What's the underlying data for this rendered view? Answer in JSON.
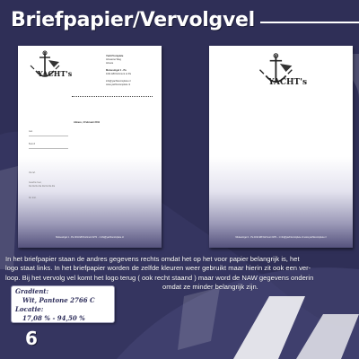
{
  "page": {
    "title": "Briefpapier/Vervolgvel",
    "page_number": "6"
  },
  "colors": {
    "background": "#2f2f57",
    "accent": "#ffffff",
    "gradient_dark": "#55527d"
  },
  "letterhead": {
    "logo_text": "YACHT's",
    "sender_lines": [
      "Yacht'Complete",
      "Almeerse Weg",
      "Almere",
      "",
      "Mutsesingel 1 - Pa",
      "1011 EB Dortmunt ot Pa",
      "",
      "info@yachtscomplete.nl",
      "www.yachtscomplete.nl"
    ],
    "place_date": "Almere, 4 Februari 2011",
    "fields": [
      "Aan",
      "Betreft",
      "Uw ref."
    ],
    "body_lines": [
      "Geachte heer,",
      "bla bla bla bla bla bla bla bla"
    ],
    "closing": "Gr. mvr.",
    "footer": "Mutsesingel 1 - Pa  1011 EB Dortmunt  0271 - 1 info@yachtscomplete.nl"
  },
  "vervolgvel": {
    "logo_text": "YACHT's",
    "footer": "Mutsesingel 1 - Pa  1011 EB Dortmunt  0271 - 1 info@yachtscomplete.nl  www.yachtscomplete.nl"
  },
  "description": {
    "lines": [
      "In het briefpapier staan de andres gegevens rechts omdat het op het voor papier belangrijk is, het",
      "logo staat links. In het briefpapier worden de zelfde kleuren weer gebruikt maar hierin zit ook een ver-",
      "loop. Bij het vervolg vel komt het logo terug ( ook recht staand ) maar word de NAW gegevens onderin",
      "omdat ze minder belangrijk zijn."
    ]
  },
  "spec": {
    "gradient_label": "Gradient:",
    "gradient_value": "Wit, Pantone 2766 C",
    "location_label": "Locatie:",
    "location_value": "17,08 % - 94,50 %"
  }
}
